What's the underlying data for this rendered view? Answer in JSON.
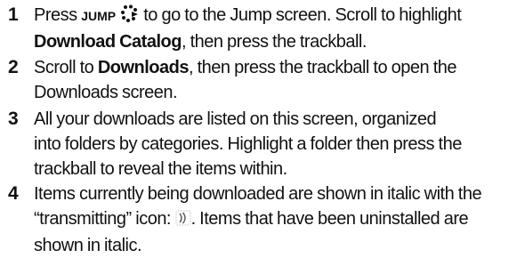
{
  "steps": [
    {
      "number": "1",
      "line1": {
        "pre": "Press",
        "key_label": "JUMP",
        "key_icon": "jump-dots-icon",
        "post": "to go to the Jump screen. Scroll to highlight"
      },
      "line2": {
        "bold": "Download Catalog",
        "post": ", then press the trackball."
      }
    },
    {
      "number": "2",
      "line1": {
        "pre": "Scroll to",
        "bold": "Downloads",
        "post": ", then press the trackball to open the"
      },
      "line2": "Downloads screen."
    },
    {
      "number": "3",
      "line1": "All your downloads are listed on this screen, organized",
      "line2": "into folders by categories. Highlight a folder then press the",
      "line3": "trackball to reveal the items within."
    },
    {
      "number": "4",
      "line1": "Items currently being downloaded are shown in italic with the",
      "line2": {
        "pre": "“transmitting” icon:",
        "icon": "transmitting-icon",
        "post": ". Items that have been uninstalled are"
      },
      "line3": "shown in italic."
    }
  ]
}
